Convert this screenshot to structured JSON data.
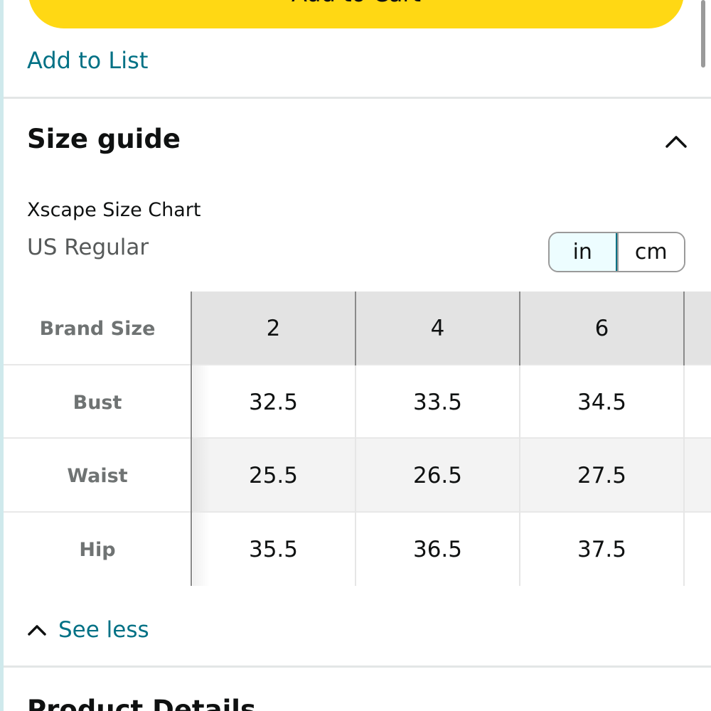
{
  "cart": {
    "label": "Add to Cart"
  },
  "add_to_list": "Add to List",
  "size_guide": {
    "title": "Size guide",
    "chart_name": "Xscape Size Chart",
    "region": "US Regular",
    "units": {
      "in": "in",
      "cm": "cm",
      "selected": "in"
    },
    "table": {
      "header_label": "Brand Size",
      "sizes": [
        "2",
        "4",
        "6"
      ],
      "rows": [
        {
          "label": "Bust",
          "values": [
            "32.5",
            "33.5",
            "34.5"
          ]
        },
        {
          "label": "Waist",
          "values": [
            "25.5",
            "26.5",
            "27.5"
          ]
        },
        {
          "label": "Hip",
          "values": [
            "35.5",
            "36.5",
            "37.5"
          ]
        }
      ]
    },
    "see_less": "See less"
  },
  "product_details": {
    "title": "Product Details"
  },
  "colors": {
    "cart_yellow": "#ffd814",
    "link_teal": "#007185",
    "text": "#0f1111",
    "muted": "#565959"
  },
  "icons": {
    "collapse": "chevron-up-icon",
    "see_less": "chevron-up-icon"
  }
}
